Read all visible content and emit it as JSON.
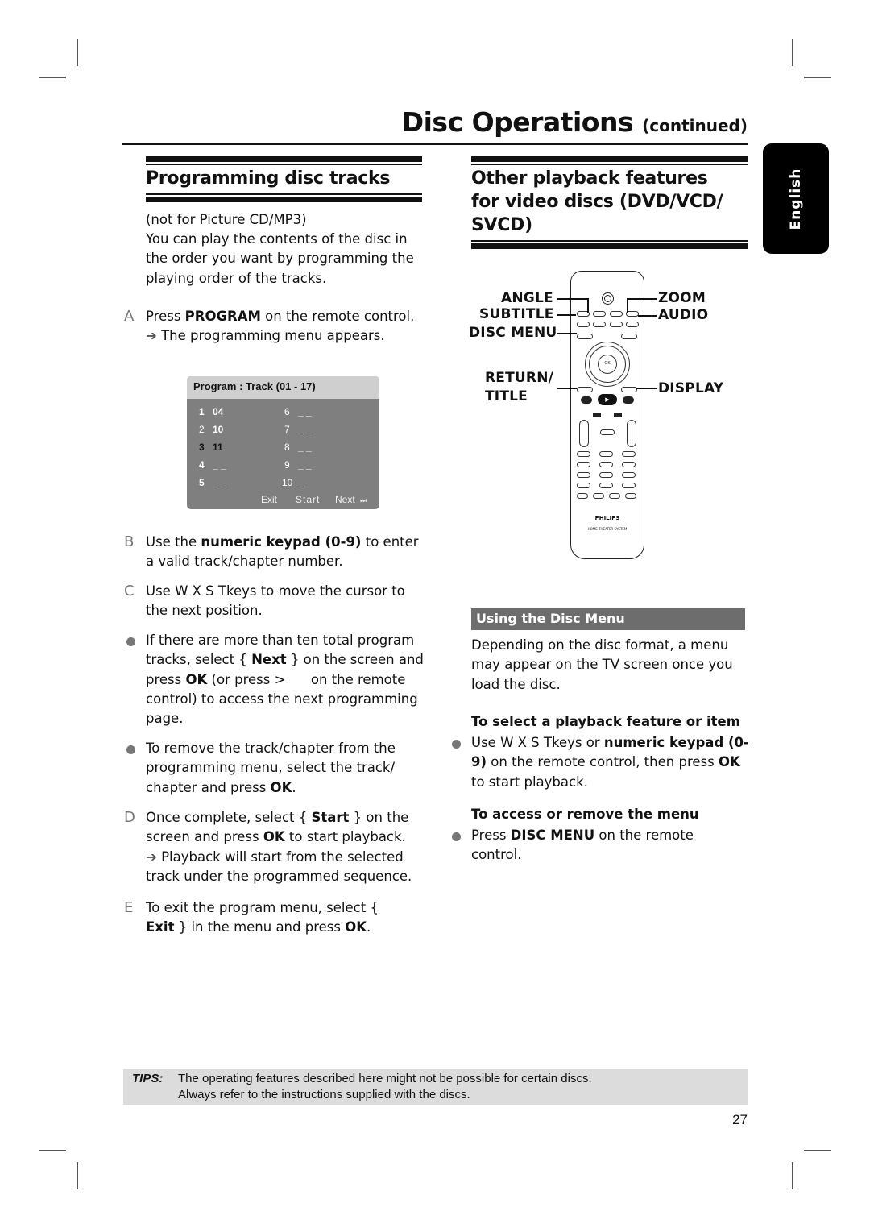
{
  "header": {
    "title": "Disc Operations",
    "title_suffix": "(continued)",
    "language_tab": "English"
  },
  "left_section": {
    "heading": "Programming disc tracks",
    "note": "(not for Picture CD/MP3)",
    "intro": "You can play the contents of the disc in the order you want by programming the playing order of the tracks.",
    "step_a": {
      "marker": "A",
      "pre": "Press ",
      "bold": "PROGRAM",
      "post": " on the remote control.",
      "result": "The programming menu appears."
    },
    "program_screen": {
      "title": "Program : Track (01 - 17)",
      "slots": [
        {
          "num": "1",
          "value": "04"
        },
        {
          "num": "2",
          "value": "10"
        },
        {
          "num": "3",
          "value": "11"
        },
        {
          "num": "4",
          "value": "_ _"
        },
        {
          "num": "5",
          "value": "_ _"
        },
        {
          "num": "6",
          "value": "_ _"
        },
        {
          "num": "7",
          "value": "_ _"
        },
        {
          "num": "8",
          "value": "_ _"
        },
        {
          "num": "9",
          "value": "_ _"
        },
        {
          "num": "10",
          "value": "_ _"
        }
      ],
      "exit_label": "Exit",
      "start_label": "Start",
      "next_label": "Next",
      "next_icon": "⏭"
    },
    "step_b": {
      "marker": "B",
      "pre": "Use the ",
      "bold": "numeric keypad (0-9)",
      "post": " to enter a valid track/chapter number."
    },
    "step_c": {
      "marker": "C",
      "text": "Use  W X S Tkeys to move the cursor to the next position."
    },
    "bullet_1": {
      "p1": "If there are more than ten total program tracks, select { ",
      "b1": "Next",
      "p2": " } on the screen and press ",
      "b2": "OK",
      "p3": " (or press >      on the remote control) to access the next programming page."
    },
    "bullet_2": {
      "p1": "To remove the track/chapter from the programming menu, select the track/ chapter and press ",
      "b1": "OK",
      "p2": "."
    },
    "step_d": {
      "marker": "D",
      "p1": "Once complete, select { ",
      "b1": "Start",
      "p2": " } on the screen and press ",
      "b2": "OK",
      "p3": " to start playback.",
      "result": "Playback will start from the selected track under the programmed sequence."
    },
    "step_e": {
      "marker": "E",
      "p1": "To exit the program menu, select { ",
      "b1": "Exit",
      "p2": " } in the menu and press ",
      "b2": "OK",
      "p3": "."
    }
  },
  "right_section": {
    "heading": "Other playback features for video discs (DVD/VCD/ SVCD)",
    "remote_labels": {
      "angle": "ANGLE",
      "subtitle": "SUBTITLE",
      "disc_menu": "DISC MENU",
      "return_title_1": "RETURN/",
      "return_title_2": "TITLE",
      "zoom": "ZOOM",
      "audio": "AUDIO",
      "display": "DISPLAY"
    },
    "remote_brand": "PHILIPS",
    "remote_model": "HOME THEATER SYSTEM",
    "remote_ok": "OK",
    "subsection_title": "Using the Disc Menu",
    "subsection_intro": "Depending on the disc format, a menu may appear on the TV screen once you load the disc.",
    "select_heading": "To select a playback feature or item",
    "select_bullet": {
      "p1": "Use  W X S Tkeys or ",
      "b1": "numeric keypad (0-9)",
      "p2": " on the remote control, then press ",
      "b2": "OK",
      "p3": " to start playback."
    },
    "access_heading": "To access or remove the menu",
    "access_bullet": {
      "p1": "Press ",
      "b1": "DISC MENU",
      "p2": " on the remote control."
    }
  },
  "footer": {
    "tips_label": "TIPS:",
    "tips_line1": "The operating features described here might not be possible for certain discs.",
    "tips_line2": "Always refer to the instructions supplied with the discs.",
    "page_number": "27"
  }
}
